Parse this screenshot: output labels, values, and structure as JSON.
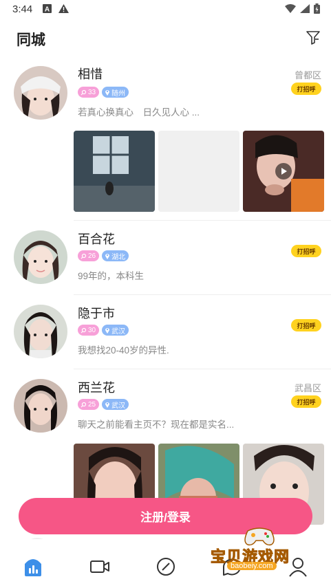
{
  "status_bar": {
    "time": "3:44"
  },
  "header": {
    "title": "同城"
  },
  "users": [
    {
      "name": "相惜",
      "age": "33",
      "location": "随州",
      "bio": "若真心换真心　日久见人心 ...",
      "district": "曾都区",
      "greet_label": "打招呼",
      "photos": [
        "room-window-photo",
        "blank-photo",
        "video-selfie-photo"
      ]
    },
    {
      "name": "百合花",
      "age": "26",
      "location": "湖北",
      "bio": "99年的，本科生",
      "district": "",
      "greet_label": "打招呼",
      "photos": []
    },
    {
      "name": "隐于市",
      "age": "30",
      "location": "武汉",
      "bio": "我想找20-40岁的异性.",
      "district": "",
      "greet_label": "打招呼",
      "photos": []
    },
    {
      "name": "西兰花",
      "age": "25",
      "location": "武汉",
      "bio": "聊天之前能看主页不？现在都是实名...",
      "district": "武昌区",
      "greet_label": "打招呼",
      "photos": [
        "selfie-photo-1",
        "selfie-photo-2",
        "selfie-photo-3"
      ]
    }
  ],
  "register_button": {
    "label": "注册/登录"
  },
  "tabs": [
    "home-tab",
    "video-tab",
    "discover-tab",
    "message-tab",
    "profile-tab"
  ],
  "watermark": {
    "text": "宝贝游戏网",
    "url": "baobeiy.com"
  },
  "colors": {
    "accent": "#f65686",
    "greet": "#ffd21f",
    "age_tag": "#f7a0d8",
    "loc_tag": "#8cb8f7",
    "home_tab": "#3d8fe8"
  }
}
